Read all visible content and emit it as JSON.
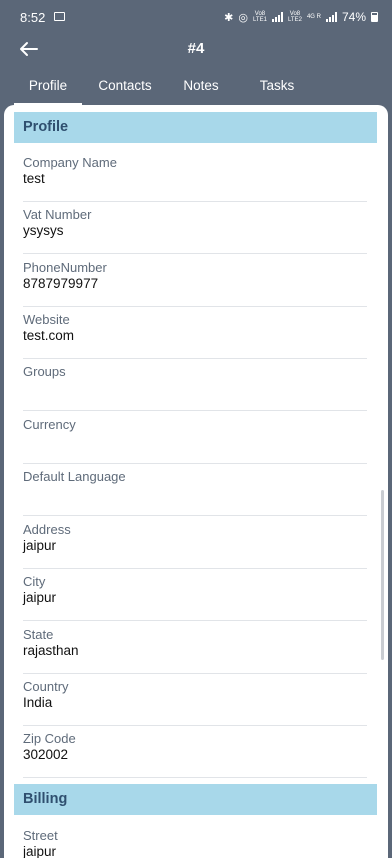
{
  "status_bar": {
    "time": "8:52",
    "battery": "74%",
    "sim1": "Vo8 LTE1",
    "sim2": "Vo8 LTE2",
    "network": "4G R"
  },
  "header": {
    "title": "#4"
  },
  "tabs": [
    {
      "label": "Profile",
      "active": true
    },
    {
      "label": "Contacts",
      "active": false
    },
    {
      "label": "Notes",
      "active": false
    },
    {
      "label": "Tasks",
      "active": false
    }
  ],
  "profile": {
    "title": "Profile",
    "fields": [
      {
        "label": "Company Name",
        "value": "test"
      },
      {
        "label": "Vat Number",
        "value": "ysysys"
      },
      {
        "label": "PhoneNumber",
        "value": "8787979977"
      },
      {
        "label": "Website",
        "value": "test.com"
      },
      {
        "label": "Groups",
        "value": ""
      },
      {
        "label": "Currency",
        "value": ""
      },
      {
        "label": "Default Language",
        "value": ""
      },
      {
        "label": "Address",
        "value": "jaipur"
      },
      {
        "label": "City",
        "value": "jaipur"
      },
      {
        "label": "State",
        "value": "rajasthan"
      },
      {
        "label": "Country",
        "value": "India"
      },
      {
        "label": "Zip Code",
        "value": "302002"
      }
    ]
  },
  "billing": {
    "title": "Billing",
    "fields": [
      {
        "label": "Street",
        "value": "jaipur"
      }
    ]
  },
  "colors": {
    "header_bg": "#5b6778",
    "section_header_bg": "#a8d8ea",
    "section_header_text": "#2f4f6f"
  },
  "icons": {
    "back": "arrow-left-icon",
    "gallery": "image-icon",
    "bluetooth": "bluetooth-icon",
    "hotspot": "hotspot-icon",
    "battery": "battery-icon"
  }
}
